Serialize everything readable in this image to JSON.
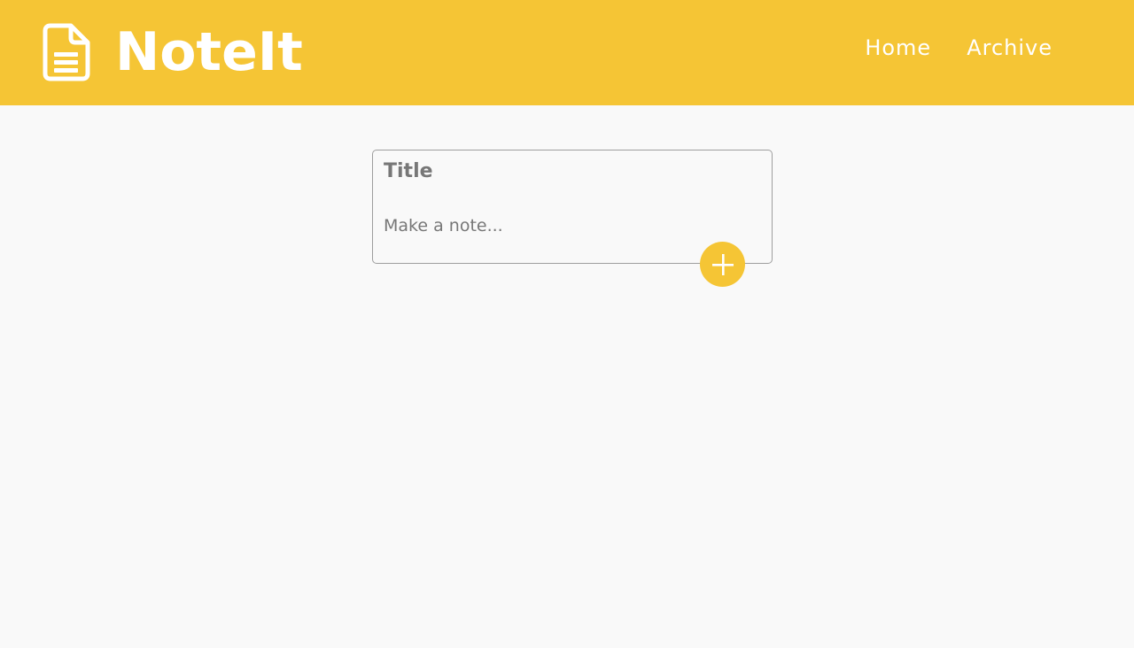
{
  "app": {
    "name": "NoteIt",
    "brand_icon": "document-icon",
    "accent_color": "#f5c535"
  },
  "nav": {
    "items": [
      {
        "label": "Home"
      },
      {
        "label": "Archive"
      }
    ]
  },
  "note_form": {
    "title_placeholder": "Title",
    "title_value": "",
    "body_placeholder": "Make a note...",
    "body_value": "",
    "add_icon": "plus-icon"
  }
}
